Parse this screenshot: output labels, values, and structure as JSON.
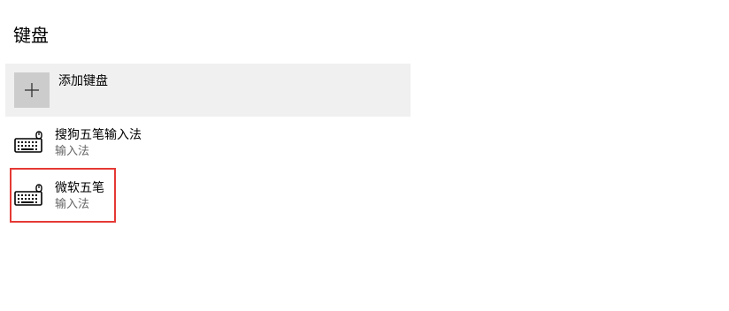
{
  "section": {
    "title": "键盘"
  },
  "add_keyboard": {
    "label": "添加键盘",
    "icon": "plus-icon"
  },
  "keyboards": [
    {
      "name": "搜狗五笔输入法",
      "type": "输入法",
      "icon": "keyboard-icon"
    },
    {
      "name": "微软五笔",
      "type": "输入法",
      "icon": "keyboard-icon",
      "highlighted": true
    }
  ],
  "colors": {
    "highlight_border": "#e53935",
    "add_row_bg": "#f0f0f0",
    "add_tile_bg": "#cccccc",
    "secondary_text": "#666666"
  }
}
